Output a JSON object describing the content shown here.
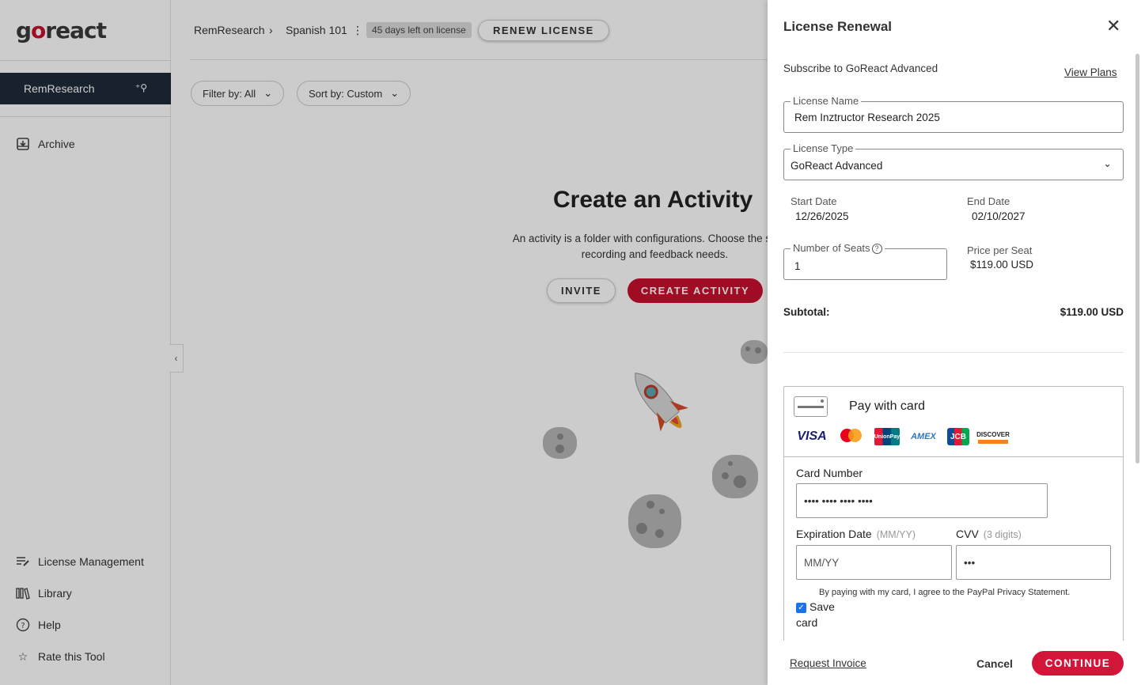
{
  "brand": {
    "logo_text_a": "g",
    "logo_text_o": "o",
    "logo_text_b": "react",
    "accent": "#c8102e"
  },
  "sidebar": {
    "org_name": "RemResearch",
    "org_icon": "user-add-icon",
    "archive_label": "Archive",
    "bottom_items": [
      {
        "label": "License Management",
        "icon": "license-management-icon"
      },
      {
        "label": "Library",
        "icon": "library-icon"
      },
      {
        "label": "Help",
        "icon": "help-circle-icon"
      },
      {
        "label": "Rate this Tool",
        "icon": "star-icon"
      }
    ]
  },
  "topbar": {
    "breadcrumb_org": "RemResearch",
    "breadcrumb_course": "Spanish 101",
    "license_badge": "45 days left on license",
    "renew_label": "RENEW LICENSE",
    "filter_label": "Filter by: All",
    "sort_label": "Sort by: Custom"
  },
  "empty_state": {
    "title": "Create an Activity",
    "description_line1": "An activity is a folder with configurations. Choose the setting",
    "description_line2": "recording and feedback needs.",
    "invite_label": "INVITE",
    "create_label": "CREATE ACTIVITY"
  },
  "drawer": {
    "title": "License Renewal",
    "subtitle": "Subscribe to GoReact Advanced",
    "view_plans": "View Plans",
    "license_name_label": "License Name",
    "license_name_value": "Rem Inztructor Research 2025",
    "license_type_label": "License Type",
    "license_type_value": "GoReact Advanced",
    "start_date_label": "Start Date",
    "start_date_value": "12/26/2025",
    "end_date_label": "End Date",
    "end_date_value": "02/10/2027",
    "seats_label": "Number of Seats",
    "seats_value": "1",
    "price_label": "Price per Seat",
    "price_value": "$119.00 USD",
    "subtotal_label": "Subtotal:",
    "subtotal_value": "$119.00 USD",
    "payment": {
      "title": "Pay with card",
      "brands": [
        "VISA",
        "mastercard",
        "UnionPay",
        "AMEX",
        "JCB",
        "DISCOVER"
      ],
      "card_number_label": "Card Number",
      "card_number_value": "•••• •••• •••• ••••",
      "expiration_label": "Expiration Date",
      "expiration_hint": "(MM/YY)",
      "expiration_placeholder": "MM/YY",
      "cvv_label": "CVV",
      "cvv_hint": "(3 digits)",
      "cvv_value": "•••",
      "agree_text": "By paying with my card, I agree to the PayPal Privacy Statement.",
      "save_card_label": "Save card",
      "save_card_checked": true
    },
    "footer": {
      "request_invoice": "Request Invoice",
      "cancel": "Cancel",
      "continue": "CONTINUE"
    }
  }
}
